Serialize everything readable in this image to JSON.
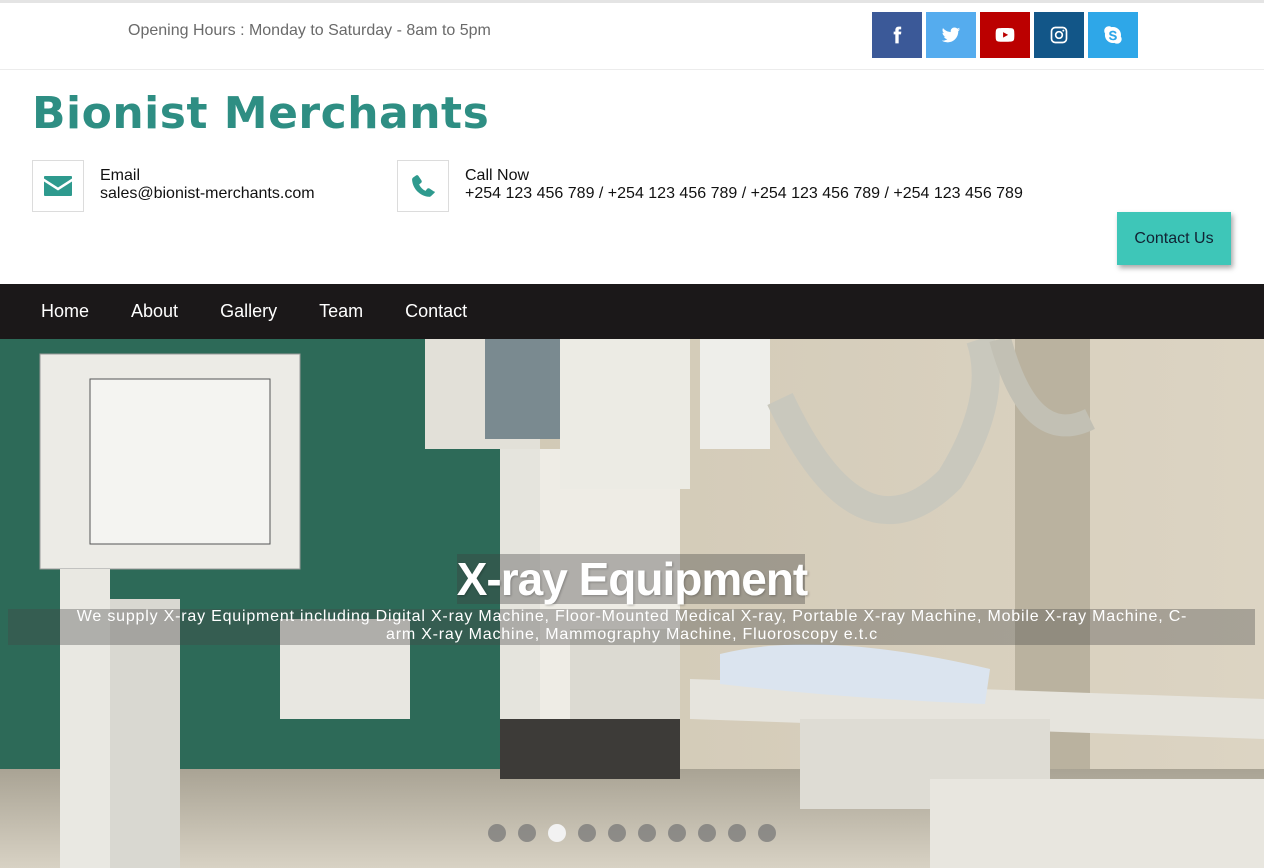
{
  "topbar": {
    "hours": "Opening Hours : Monday to Saturday - 8am to 5pm",
    "socials": [
      {
        "icon": "facebook-icon",
        "color": "#3b5998"
      },
      {
        "icon": "twitter-icon",
        "color": "#55acee"
      },
      {
        "icon": "youtube-icon",
        "color": "#bb0000"
      },
      {
        "icon": "instagram-icon",
        "color": "#125688"
      },
      {
        "icon": "skype-icon",
        "color": "#2ea7e8"
      }
    ]
  },
  "header": {
    "brand": "Bionist Merchants",
    "email": {
      "label": "Email",
      "value": "sales@bionist-merchants.com",
      "icon": "envelope-icon"
    },
    "phone": {
      "label": "Call Now",
      "value": "+254 123 456 789 / +254 123 456 789 / +254 123 456 789 / +254 123 456 789",
      "icon": "phone-icon"
    },
    "contact_button": "Contact Us"
  },
  "nav": {
    "items": [
      "Home",
      "About",
      "Gallery",
      "Team",
      "Contact"
    ]
  },
  "hero": {
    "title": "X-ray Equipment",
    "subtitle": "We supply X-ray Equipment including Digital X-ray Machine, Floor-Mounted Medical X-ray, Portable X-ray Machine, Mobile X-ray Machine, C-arm X-ray Machine, Mammography Machine, Fluoroscopy e.t.c",
    "slide_count": 10,
    "active_slide": 3
  },
  "colors": {
    "brand": "#2e8e83",
    "accent": "#3ec6b8",
    "nav_bg": "#1b1819"
  }
}
